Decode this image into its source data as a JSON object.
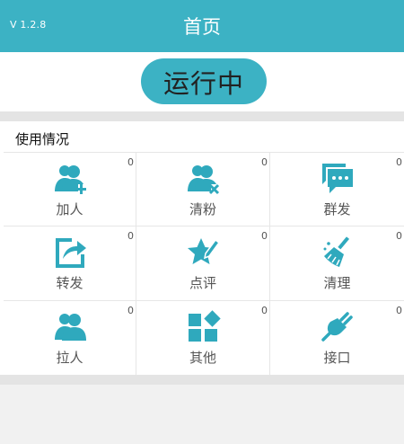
{
  "header": {
    "version": "V 1.2.8",
    "title": "首页"
  },
  "status": {
    "label": "运行中"
  },
  "usage": {
    "title": "使用情况",
    "items": [
      {
        "label": "加人",
        "count": "0",
        "icon": "add-user-icon"
      },
      {
        "label": "清粉",
        "count": "0",
        "icon": "remove-user-icon"
      },
      {
        "label": "群发",
        "count": "0",
        "icon": "chat-bubbles-icon"
      },
      {
        "label": "转发",
        "count": "0",
        "icon": "share-icon"
      },
      {
        "label": "点评",
        "count": "0",
        "icon": "star-pencil-icon"
      },
      {
        "label": "清理",
        "count": "0",
        "icon": "broom-icon"
      },
      {
        "label": "拉人",
        "count": "0",
        "icon": "users-icon"
      },
      {
        "label": "其他",
        "count": "0",
        "icon": "grid-icon"
      },
      {
        "label": "接口",
        "count": "0",
        "icon": "plug-icon"
      }
    ]
  },
  "colors": {
    "accent": "#3cb2c4",
    "icon": "#2fa9bd",
    "background": "#f1f1f1",
    "divider": "#e4e4e4"
  }
}
